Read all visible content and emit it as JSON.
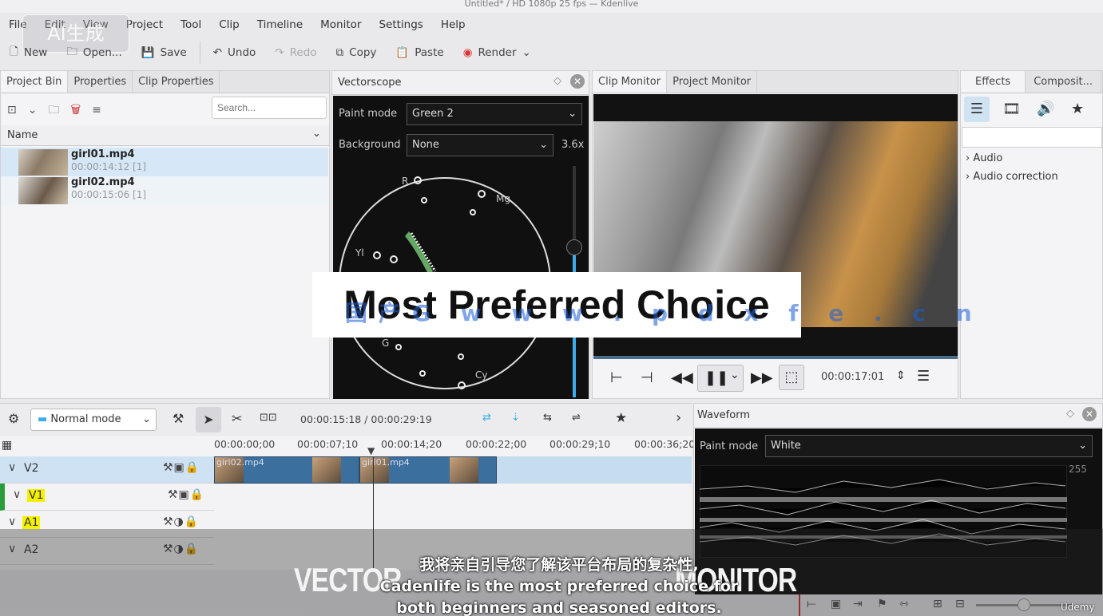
{
  "window": {
    "title": "Untitled* / HD 1080p 25 fps — Kdenlive"
  },
  "watermark": "AI生成",
  "menu": [
    "File",
    "Edit",
    "View",
    "Project",
    "Tool",
    "Clip",
    "Timeline",
    "Monitor",
    "Settings",
    "Help"
  ],
  "toolbar": {
    "new": "New",
    "open": "Open...",
    "save": "Save",
    "undo": "Undo",
    "redo": "Redo",
    "copy": "Copy",
    "paste": "Paste",
    "render": "Render"
  },
  "bin": {
    "tabs": [
      "Project Bin",
      "Properties",
      "Clip Properties"
    ],
    "search_placeholder": "Search...",
    "column": "Name",
    "items": [
      {
        "name": "girl01.mp4",
        "meta": "00:00:14:12 [1]"
      },
      {
        "name": "girl02.mp4",
        "meta": "00:00:15:06 [1]"
      }
    ]
  },
  "vectorscope": {
    "title": "Vectorscope",
    "paint_mode_label": "Paint mode",
    "paint_mode": "Green 2",
    "background_label": "Background",
    "background": "None",
    "zoom": "3.6x",
    "labels": {
      "r": "R",
      "mg": "Mg",
      "yl": "Yl",
      "g": "G",
      "cy": "Cy"
    }
  },
  "monitor": {
    "tabs": [
      "Clip Monitor",
      "Project Monitor"
    ],
    "timecode": "00:00:17:01"
  },
  "effects": {
    "tabs": [
      "Effects",
      "Composit..."
    ],
    "tree": [
      "Audio",
      "Audio correction"
    ]
  },
  "timeline": {
    "mode": "Normal mode",
    "position": "00:00:15:18 / 00:00:29:19",
    "ruler": [
      "00:00:00;00",
      "00:00:07;10",
      "00:00:14;20",
      "00:00:22;00",
      "00:00:29;10",
      "00:00:36;20"
    ],
    "tracks": [
      "V2",
      "V1",
      "A1",
      "A2"
    ],
    "clips": [
      "girl02.mp4",
      "girl01.mp4"
    ]
  },
  "waveform": {
    "title": "Waveform",
    "paint_mode_label": "Paint mode",
    "paint_mode": "White",
    "scale": "255"
  },
  "overlay": {
    "headline": "Most Preferred Choice",
    "site_mark": "国产G w w w . p d x f e . c n",
    "big_left": "VECTOR",
    "big_right": "MONITOR",
    "caption_cn": "我将亲自引导您了解该平台布局的复杂性,",
    "caption_en1": "Cadenlife is the most preferred choice for",
    "caption_en2": "both beginners and seasoned editors.",
    "brand": "Udemy"
  },
  "colors": {
    "accent": "#3daee9",
    "clip_blue": "#3a6f9e",
    "track_highlight": "#f4f000"
  }
}
